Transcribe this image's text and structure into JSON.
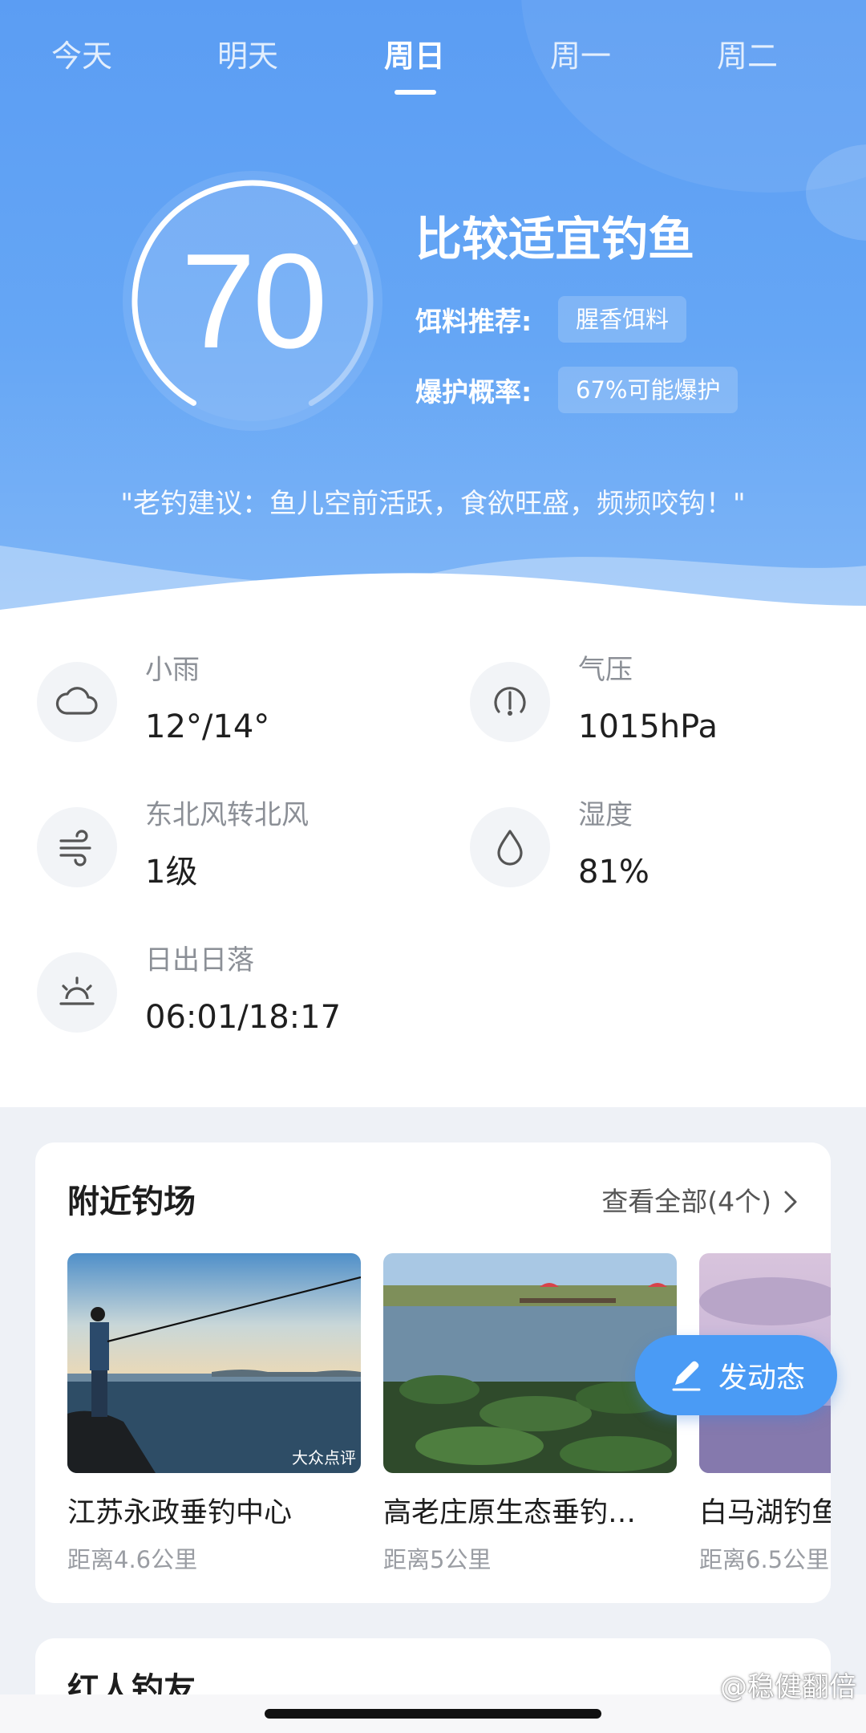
{
  "tabs": [
    {
      "label": "今天"
    },
    {
      "label": "明天"
    },
    {
      "label": "周日"
    },
    {
      "label": "周一"
    },
    {
      "label": "周二"
    }
  ],
  "active_tab": "周日",
  "score": {
    "value": "70",
    "fraction": 0.7
  },
  "rating": {
    "title": "比较适宜钓鱼",
    "bait_label": "饵料推荐:",
    "bait_value": "腥香饵料",
    "explode_label": "爆护概率:",
    "explode_value": "67%可能爆护"
  },
  "advice": "\"老钓建议：鱼儿空前活跃，食欲旺盛，频频咬钩！\"",
  "weather": {
    "condition": {
      "label": "小雨",
      "value": "12°/14°",
      "icon": "cloud-icon"
    },
    "pressure": {
      "label": "气压",
      "value": "1015hPa",
      "icon": "pressure-gauge-icon"
    },
    "wind": {
      "label": "东北风转北风",
      "value": "1级",
      "icon": "wind-icon"
    },
    "humidity": {
      "label": "湿度",
      "value": "81%",
      "icon": "water-drop-icon"
    },
    "sun": {
      "label": "日出日落",
      "value": "06:01/18:17",
      "icon": "sunrise-icon"
    }
  },
  "nearby": {
    "title": "附近钓场",
    "more_label": "查看全部(4个)",
    "spots": [
      {
        "name": "江苏永政垂钓中心",
        "distance": "距离4.6公里",
        "image_watermark": "大众点评"
      },
      {
        "name": "高老庄原生态垂钓…",
        "distance": "距离5公里"
      },
      {
        "name": "白马湖钓鱼",
        "distance": "距离6.5公里"
      }
    ]
  },
  "fab": {
    "label": "发动态",
    "icon": "edit-pen-icon"
  },
  "friends": {
    "title": "红人钓友"
  },
  "watermark": "@稳健翻倍",
  "colors": {
    "hero_blue": "#5b9df3",
    "fab_blue": "#4a9bf5"
  }
}
